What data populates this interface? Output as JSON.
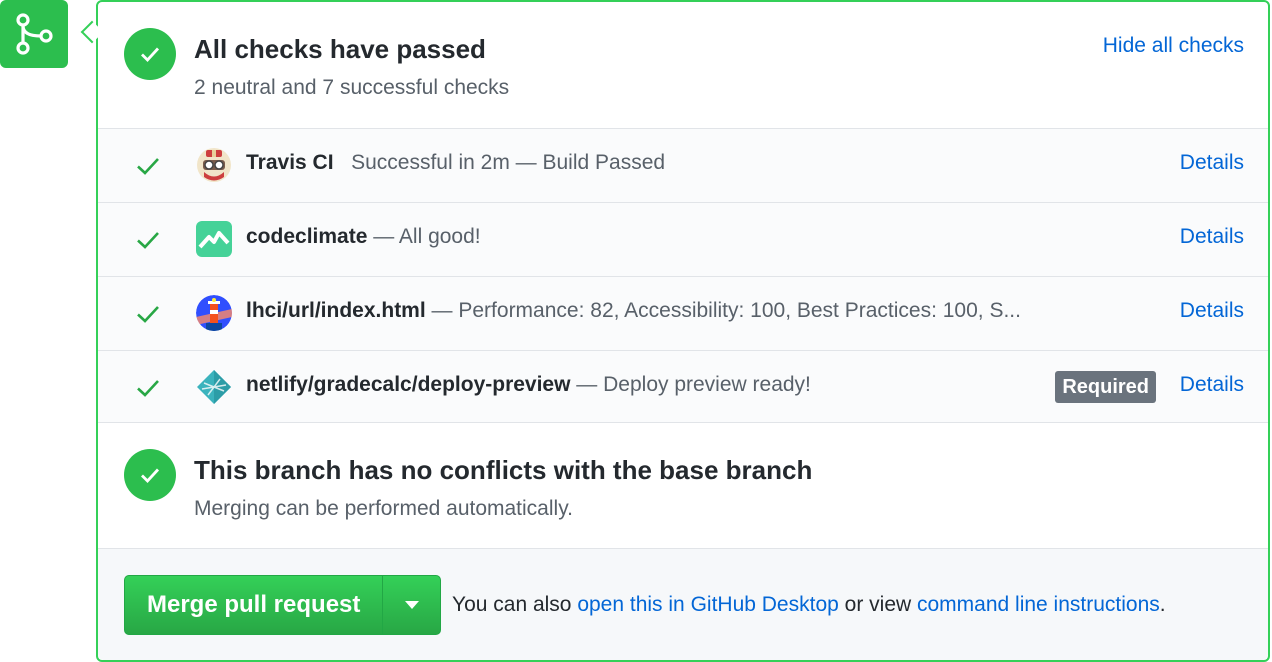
{
  "checks_header": {
    "title": "All checks have passed",
    "subtitle": "2 neutral and 7 successful checks",
    "hide_link": "Hide all checks"
  },
  "checks": [
    {
      "name": "Travis CI",
      "separator": "   ",
      "description": "Successful in 2m — Build Passed",
      "required": "",
      "details": "Details",
      "icon": "travis-ci-icon"
    },
    {
      "name": "codeclimate",
      "separator": " — ",
      "description": "All good!",
      "required": "",
      "details": "Details",
      "icon": "codeclimate-icon"
    },
    {
      "name": "lhci/url/index.html",
      "separator": " — ",
      "description": "Performance: 82, Accessibility: 100, Best Practices: 100, S...",
      "required": "",
      "details": "Details",
      "icon": "lighthouse-icon"
    },
    {
      "name": "netlify/gradecalc/deploy-preview",
      "separator": " — ",
      "description": "Deploy preview ready!",
      "required": "Required",
      "details": "Details",
      "icon": "netlify-icon"
    }
  ],
  "merge_status": {
    "title": "This branch has no conflicts with the base branch",
    "subtitle": "Merging can be performed automatically."
  },
  "actions": {
    "merge_button": "Merge pull request",
    "alt_prefix": "You can also ",
    "desktop_link": "open this in GitHub Desktop",
    "alt_middle": " or view ",
    "cli_link": "command line instructions",
    "alt_suffix": "."
  },
  "colors": {
    "success": "#2cbe4e",
    "link": "#0366d6",
    "border_success": "#34d058"
  }
}
